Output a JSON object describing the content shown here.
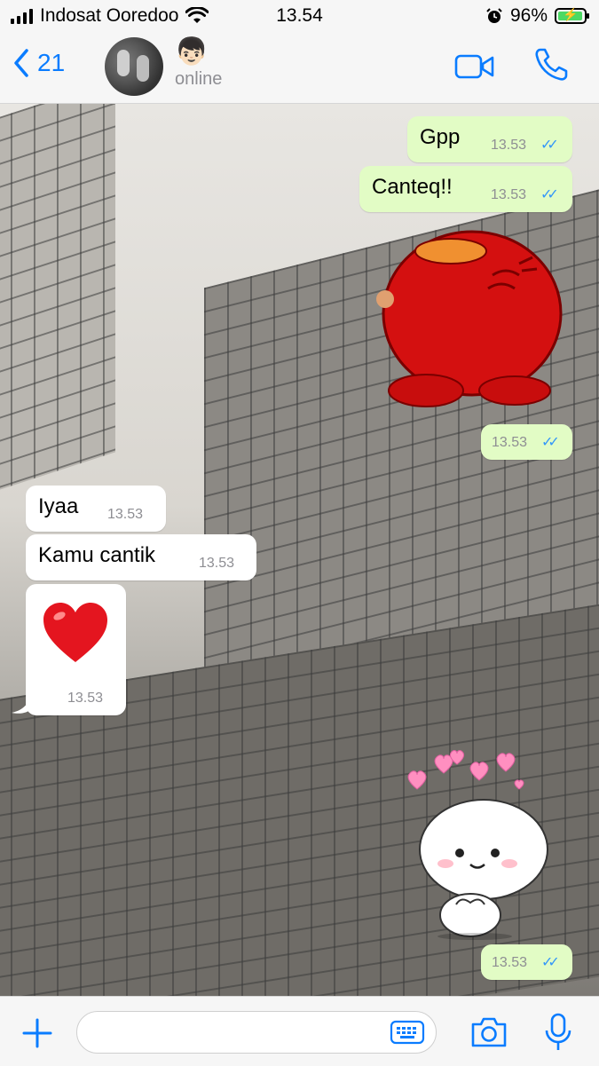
{
  "status_bar": {
    "carrier": "Indosat Ooredoo",
    "time": "13.54",
    "battery": "96%",
    "battery_level": 0.96
  },
  "header": {
    "back_count": "21",
    "contact_emoji": "👦🏻",
    "contact_status": "online"
  },
  "messages": [
    {
      "dir": "out",
      "text": "Gpp",
      "time": "13.53"
    },
    {
      "dir": "out",
      "text": "Canteq!!",
      "time": "13.53"
    },
    {
      "dir": "out",
      "type": "sticker",
      "sticker": "red-blob-sticker",
      "time": "13.53"
    },
    {
      "dir": "in",
      "text": "Iyaa",
      "time": "13.53"
    },
    {
      "dir": "in",
      "text": "Kamu cantik",
      "time": "13.53"
    },
    {
      "dir": "in",
      "text": "❤️",
      "time": "13.53"
    },
    {
      "dir": "out",
      "type": "sticker",
      "sticker": "white-character-hearts-sticker",
      "time": "13.53"
    }
  ],
  "colors": {
    "accent": "#0a7cff",
    "outgoing_bubble": "#e2fcc5",
    "incoming_bubble": "#ffffff",
    "read_ticks": "#3497f9"
  },
  "icons": [
    "back-chevron-icon",
    "video-call-icon",
    "phone-call-icon",
    "plus-icon",
    "keyboard-icon",
    "camera-icon",
    "microphone-icon",
    "wifi-icon",
    "alarm-icon",
    "battery-icon"
  ]
}
